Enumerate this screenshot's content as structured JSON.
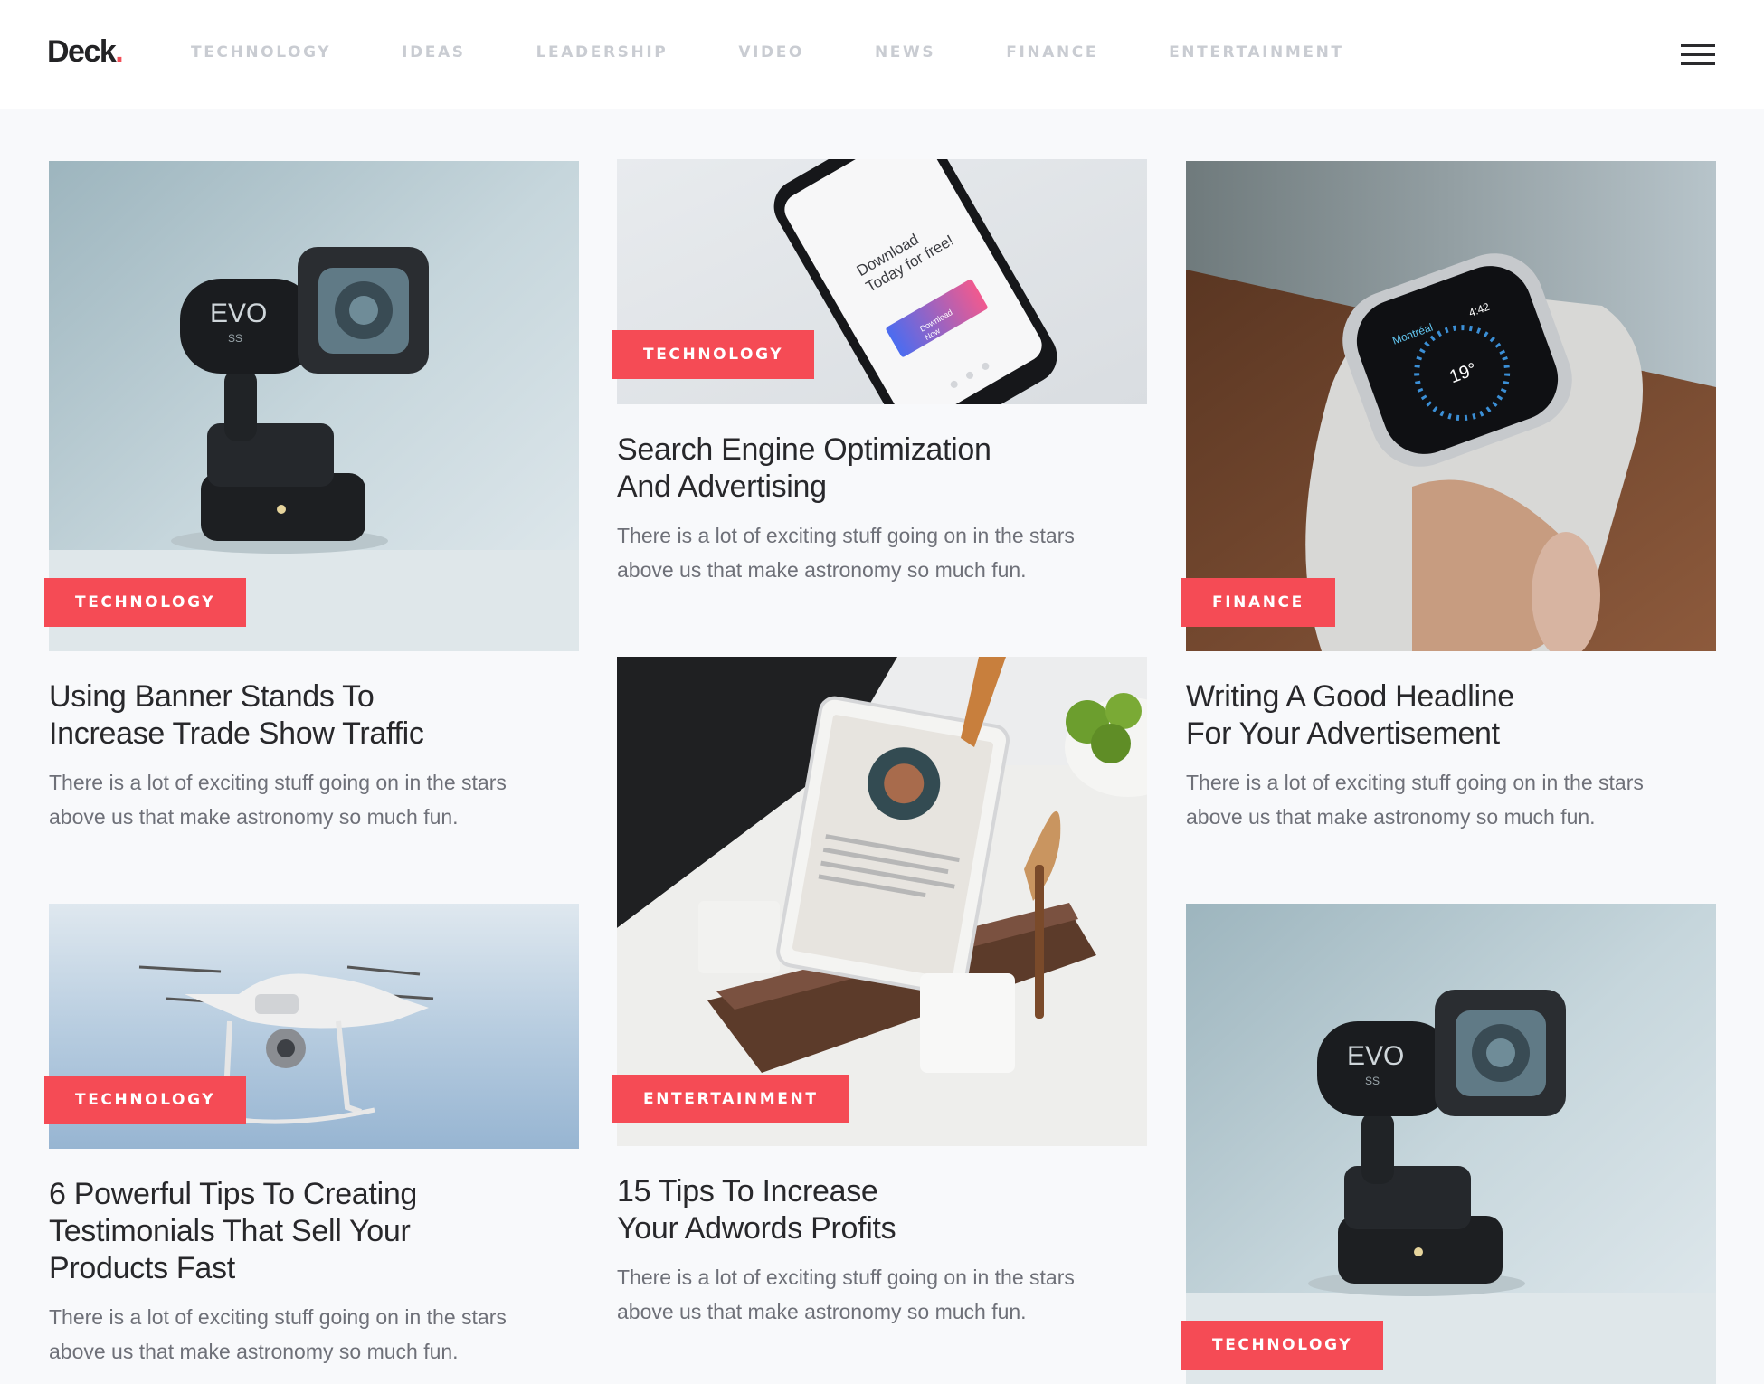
{
  "brand": {
    "name": "Deck",
    "dot": "."
  },
  "nav": {
    "items": [
      "TECHNOLOGY",
      "IDEAS",
      "LEADERSHIP",
      "VIDEO",
      "NEWS",
      "FINANCE",
      "ENTERTAINMENT"
    ]
  },
  "menu_icon": "hamburger-menu-icon",
  "colors": {
    "accent": "#f54b55",
    "nav_text": "#c9ccd2",
    "heading": "#28282b",
    "body_text": "#6e7078",
    "background": "#f8f9fb"
  },
  "posts": [
    {
      "category": "TECHNOLOGY",
      "title": "Using Banner Stands To\nIncrease Trade Show Traffic",
      "excerpt": "There is a lot of exciting stuff going on in the stars\nabove us that make astronomy so much fun.",
      "image": "gimbal-camera"
    },
    {
      "category": "TECHNOLOGY",
      "title": "Search Engine Optimization\nAnd Advertising",
      "excerpt": "There is a lot of exciting stuff going on in the stars\nabove us that make astronomy so much fun.",
      "image": "smartphone"
    },
    {
      "category": "FINANCE",
      "title": "Writing A Good Headline\nFor Your Advertisement",
      "excerpt": "There is a lot of exciting stuff going on in the stars\nabove us that make astronomy so much fun.",
      "image": "smartwatch"
    },
    {
      "category": "TECHNOLOGY",
      "title": "6 Powerful Tips To Creating\nTestimonials That Sell Your\nProducts Fast",
      "excerpt": "There is a lot of exciting stuff going on in the stars\nabove us that make astronomy so much fun.",
      "image": "drone"
    },
    {
      "category": "ENTERTAINMENT",
      "title": "15 Tips To Increase\nYour Adwords Profits",
      "excerpt": "There is a lot of exciting stuff going on in the stars\nabove us that make astronomy so much fun.",
      "image": "tablet-kitchen"
    },
    {
      "category": "TECHNOLOGY",
      "title": "",
      "excerpt": "",
      "image": "gimbal-camera"
    }
  ],
  "phone_screen": {
    "headline": "Download\nToday for free!",
    "button": "Download\nNow"
  },
  "watch_face": {
    "city": "Montréal",
    "time": "4:42",
    "temp": "19°"
  },
  "gimbal_label": {
    "brand": "EVO",
    "model": "SS"
  }
}
